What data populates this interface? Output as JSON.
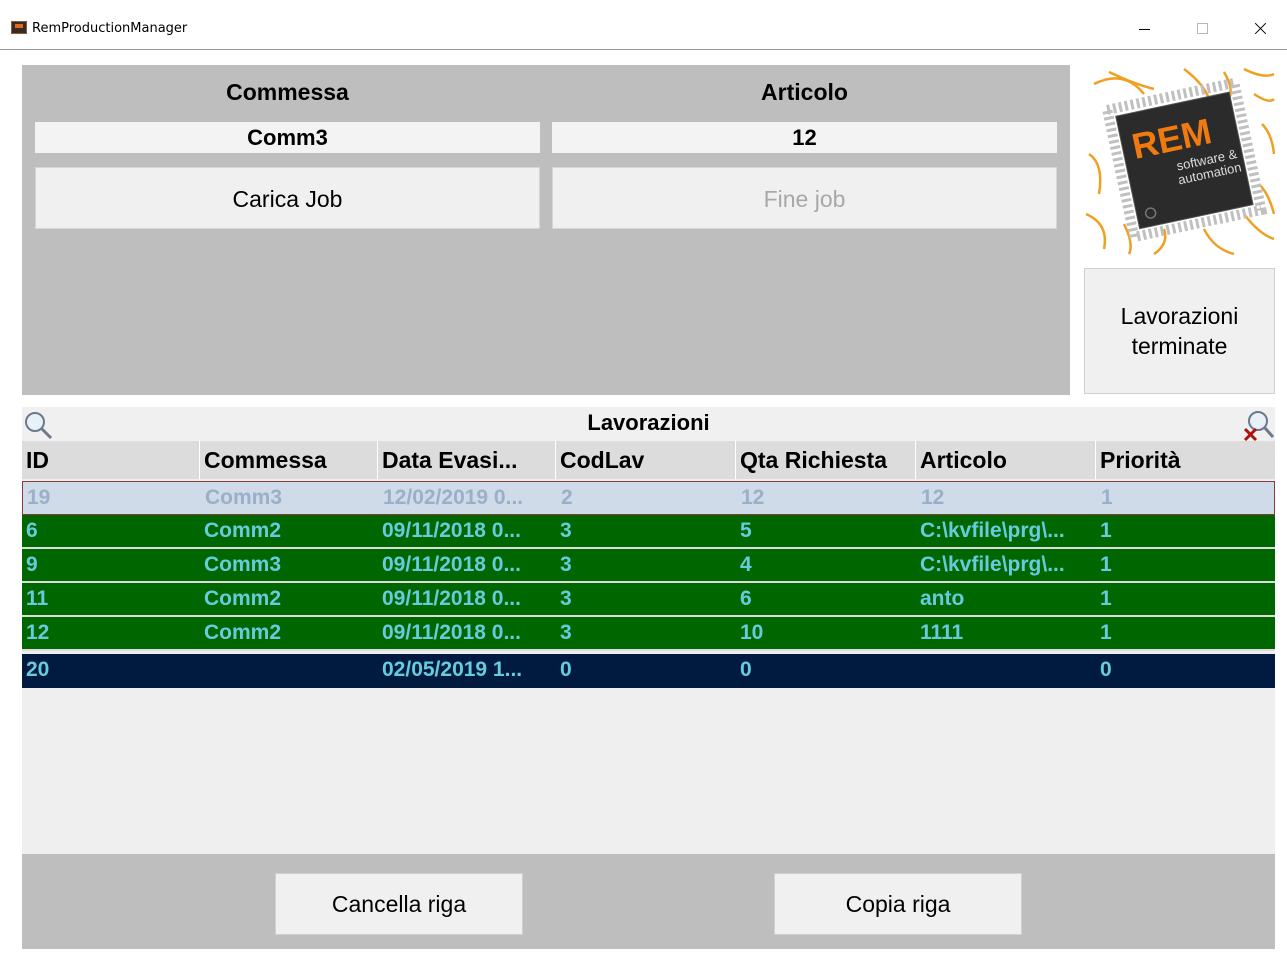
{
  "window": {
    "title": "RemProductionManager"
  },
  "job": {
    "commessa_label": "Commessa",
    "articolo_label": "Articolo",
    "commessa_value": "Comm3",
    "articolo_value": "12",
    "load_button": "Carica Job",
    "end_button": "Fine job"
  },
  "logo": {
    "brand": "REM",
    "tagline_1": "software &",
    "tagline_2": "automation"
  },
  "side": {
    "lavorazioni_terminate": "Lavorazioni terminate"
  },
  "grid": {
    "title": "Lavorazioni",
    "columns": [
      "ID",
      "Commessa",
      "Data Evasi...",
      "CodLav",
      "Qta Richiesta",
      "Articolo",
      "Priorità"
    ],
    "rows": [
      [
        "19",
        "Comm3",
        "12/02/2019 0...",
        "2",
        "12",
        "12",
        "1"
      ],
      [
        "6",
        "Comm2",
        "09/11/2018 0...",
        "3",
        "5",
        "C:\\kvfile\\prg\\...",
        "1"
      ],
      [
        "9",
        "Comm3",
        "09/11/2018 0...",
        "3",
        "4",
        "C:\\kvfile\\prg\\...",
        "1"
      ],
      [
        "11",
        "Comm2",
        "09/11/2018 0...",
        "3",
        "6",
        "anto",
        "1"
      ],
      [
        "12",
        "Comm2",
        "09/11/2018 0...",
        "3",
        "10",
        "1111",
        "1"
      ],
      [
        "20",
        "",
        "02/05/2019 1...",
        "0",
        "0",
        "",
        "0"
      ]
    ]
  },
  "actions": {
    "delete_row": "Cancella riga",
    "copy_row": "Copia riga"
  },
  "colors": {
    "panel": "#bebebe",
    "row_green": "#006600",
    "row_navy": "#001a40",
    "row_text": "#66ccdd",
    "row_selected": "#cfdbe8"
  }
}
